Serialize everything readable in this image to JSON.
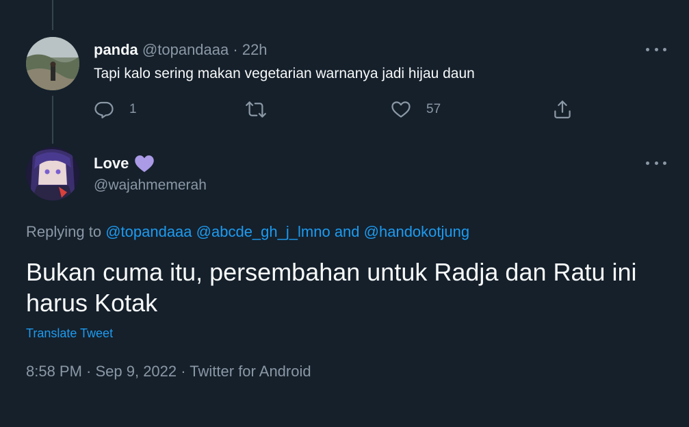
{
  "tweet1": {
    "name": "panda",
    "handle": "@topandaaa",
    "separator": "·",
    "time": "22h",
    "text": "Tapi kalo sering makan vegetarian warnanya jadi hijau daun",
    "reply_count": "1",
    "retweet_count": "",
    "like_count": "57"
  },
  "tweet2": {
    "name": "Love",
    "name_emoji": "purple-heart-icon",
    "handle": "@wajahmemerah",
    "replying_prefix": "Replying to",
    "mention1": "@topandaaa",
    "mention2": "@abcde_gh_j_lmno",
    "conjunction": "and",
    "mention3": "@handokotjung",
    "text": "Bukan cuma itu, persembahan untuk Radja dan Ratu ini harus Kotak",
    "translate_label": "Translate Tweet",
    "meta": "8:58 PM · Sep 9, 2022 · Twitter for Android"
  },
  "colors": {
    "background": "#15202b",
    "text": "#f7f9f9",
    "muted": "#8b98a5",
    "link": "#1d9bf0",
    "heart": "#ab9ae6"
  }
}
